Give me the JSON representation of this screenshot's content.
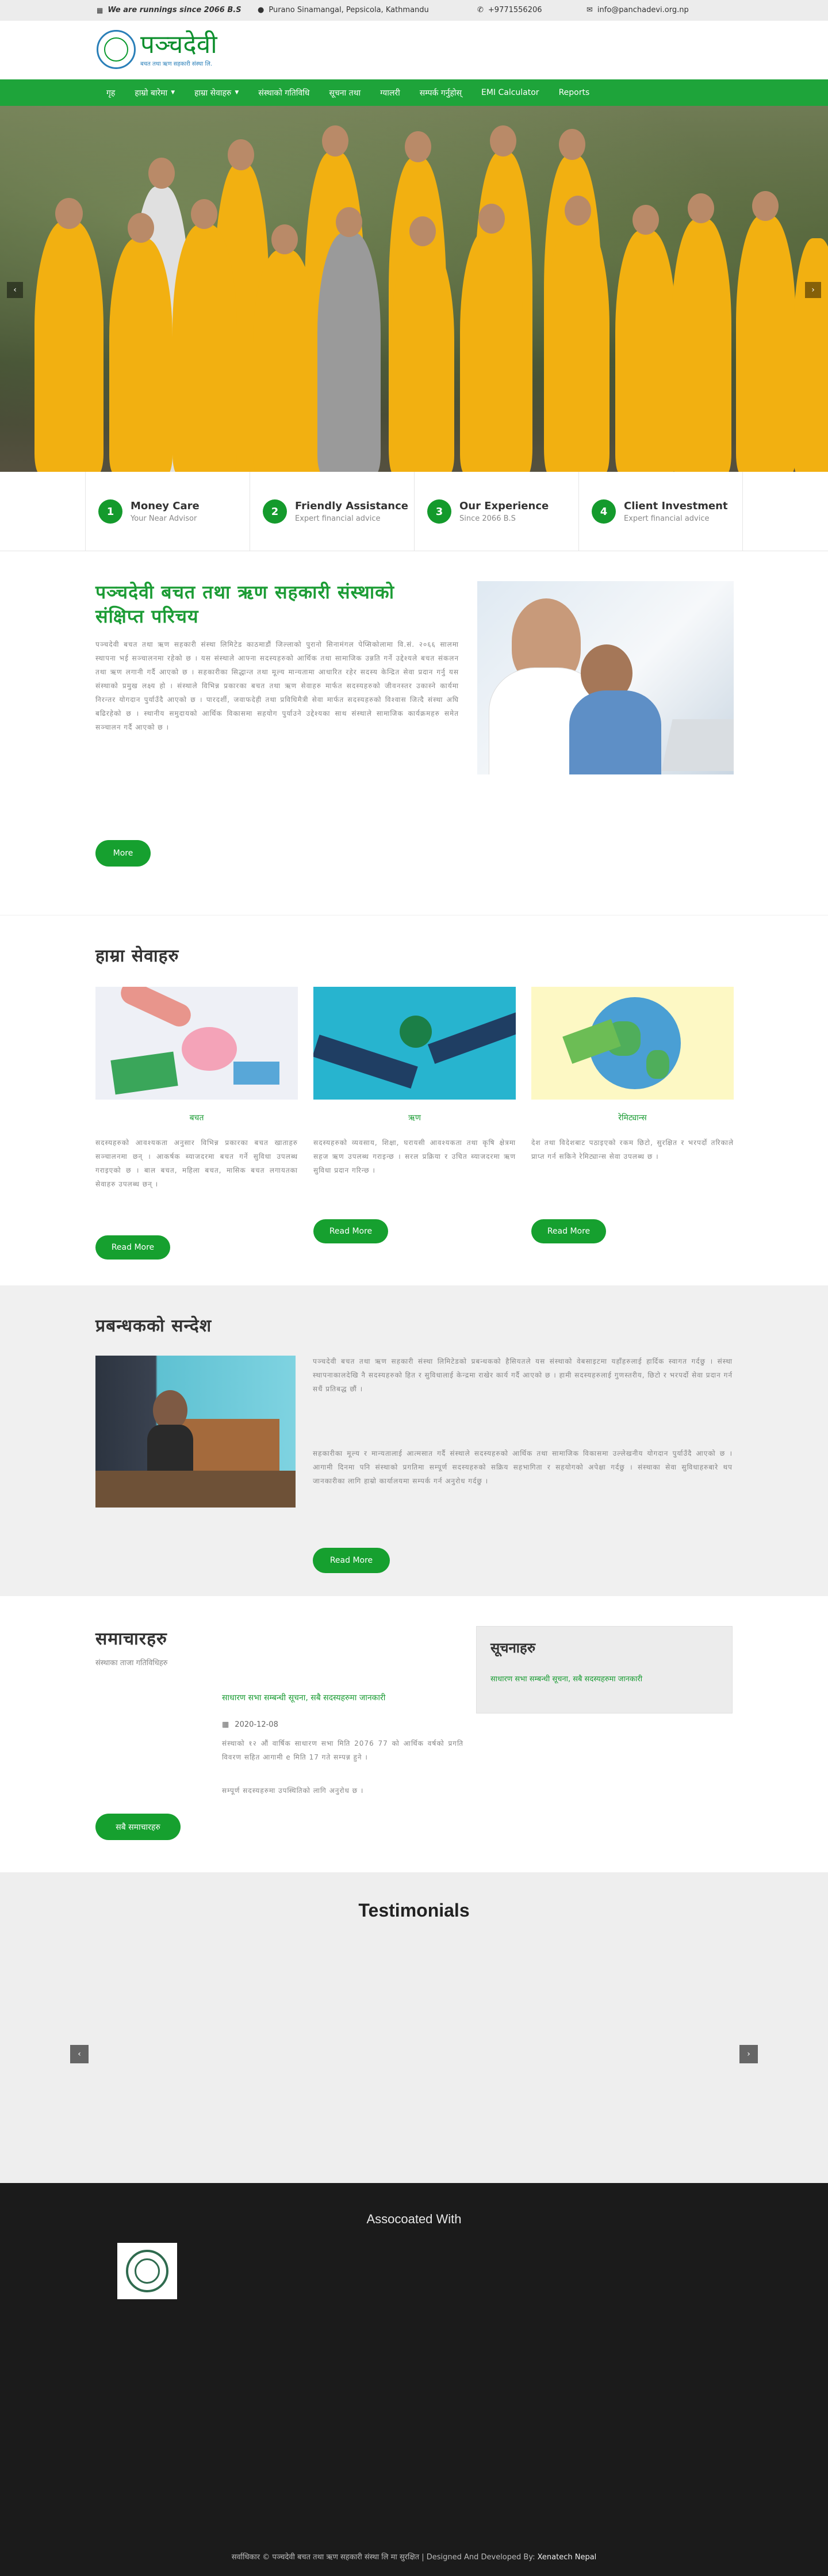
{
  "topbar": {
    "running": "We are runnings since 2066 B.S",
    "address": "Purano Sinamangal, Pepsicola, Kathmandu",
    "phone": "+9771556206",
    "email": "info@panchadevi.org.np"
  },
  "logo": {
    "title": "पञ्चदेवी",
    "subtitle": "बचत तथा ऋण सहकारी संस्था लि."
  },
  "nav": {
    "items": [
      {
        "label": "गृह"
      },
      {
        "label": "हाम्रो बारेमा",
        "dropdown": true
      },
      {
        "label": "हाम्रा सेवाहरु",
        "dropdown": true
      },
      {
        "label": "संस्थाको गतिविधि"
      },
      {
        "label": "सूचना तथा"
      },
      {
        "label": "ग्यालरी"
      },
      {
        "label": "सम्पर्क गर्नुहोस्"
      },
      {
        "label": "EMI Calculator"
      },
      {
        "label": "Reports"
      }
    ]
  },
  "features": [
    {
      "num": "1",
      "title": "Money Care",
      "sub": "Your Near Advisor"
    },
    {
      "num": "2",
      "title": "Friendly Assistance",
      "sub": "Expert financial advice"
    },
    {
      "num": "3",
      "title": "Our Experience",
      "sub": "Since 2066 B.S"
    },
    {
      "num": "4",
      "title": "Client Investment",
      "sub": "Expert financial advice"
    }
  ],
  "about": {
    "heading": "पञ्चदेवी बचत तथा ऋण सहकारी संस्थाको संक्षिप्त परिचय",
    "body": "पञ्चदेवी बचत तथा ऋण सहकारी संस्था लिमिटेड काठमाडौं जिल्लाको पुरानो सिनामंगल पेप्सिकोलामा वि.सं. २०६६ सालमा स्थापना भई सञ्चालनमा रहेको छ । यस संस्थाले आफ्ना सदस्यहरुको आर्थिक तथा सामाजिक उन्नति गर्ने उद्देश्यले बचत संकलन तथा ऋण लगानी गर्दै आएको छ । सहकारीका सिद्धान्त तथा मूल्य मान्यतामा आधारित रहेर सदस्य केन्द्रित सेवा प्रदान गर्नु यस संस्थाको प्रमुख लक्ष्य हो । संस्थाले विभिन्न प्रकारका बचत तथा ऋण सेवाहरु मार्फत सदस्यहरुको जीवनस्तर उकास्ने कार्यमा निरन्तर योगदान पुर्याउँदै आएको छ । पारदर्शी, जवाफदेही तथा प्रविधिमैत्री सेवा मार्फत सदस्यहरुको विश्वास जित्दै संस्था अघि बढिरहेको छ । स्थानीय समुदायको आर्थिक विकासमा सहयोग पुर्याउने उद्देश्यका साथ संस्थाले सामाजिक कार्यक्रमहरु समेत सञ्चालन गर्दै आएको छ ।",
    "more": "More"
  },
  "services": {
    "heading": "हाम्रा सेवाहरु",
    "items": [
      {
        "title": "बचत",
        "text": "सदस्यहरुको आवश्यकता अनुसार विभिन्न प्रकारका बचत खाताहरु सञ्चालनमा छन् । आकर्षक ब्याजदरमा बचत गर्ने सुविधा उपलब्ध गराइएको छ । बाल बचत, महिला बचत, मासिक बचत लगायतका सेवाहरु उपलब्ध छन् ।",
        "more": "Read More"
      },
      {
        "title": "ऋण",
        "text": "सदस्यहरुको व्यवसाय, शिक्षा, घरायसी आवश्यकता तथा कृषि क्षेत्रमा सहज ऋण उपलब्ध गराइन्छ । सरल प्रक्रिया र उचित ब्याजदरमा ऋण सुविधा प्रदान गरिन्छ ।",
        "more": "Read More"
      },
      {
        "title": "रेमिट्यान्स",
        "text": "देश तथा विदेशबाट पठाइएको रकम छिटो, सुरक्षित र भरपर्दो तरिकाले प्राप्त गर्न सकिने रेमिट्यान्स सेवा उपलब्ध छ ।",
        "more": "Read More"
      }
    ]
  },
  "manager": {
    "heading": "प्रबन्धकको सन्देश",
    "p1": "पञ्चदेवी बचत तथा ऋण सहकारी संस्था लिमिटेडको प्रबन्धकको हैसियतले यस संस्थाको वेबसाइटमा यहाँहरुलाई हार्दिक स्वागत गर्दछु । संस्था स्थापनाकालदेखि नै सदस्यहरुको हित र सुविधालाई केन्द्रमा राखेर कार्य गर्दै आएको छ । हामी सदस्यहरुलाई गुणस्तरीय, छिटो र भरपर्दो सेवा प्रदान गर्न सधैं प्रतिबद्ध छौं ।",
    "p2": "सहकारीका मूल्य र मान्यतालाई आत्मसात गर्दै संस्थाले सदस्यहरुको आर्थिक तथा सामाजिक विकासमा उल्लेखनीय योगदान पुर्याउँदै आएको छ । आगामी दिनमा पनि संस्थाको प्रगतिमा सम्पूर्ण सदस्यहरुको सक्रिय सहभागिता र सहयोगको अपेक्षा गर्दछु । संस्थाका सेवा सुविधाहरुबारे थप जानकारीका लागि हाम्रो कार्यालयमा सम्पर्क गर्न अनुरोध गर्दछु ।",
    "more": "Read More"
  },
  "news": {
    "heading": "समाचारहरु",
    "sub": "संस्थाका ताजा गतिविधिहरु",
    "item_title": "साधारण सभा सम्बन्धी सूचना, सबै सदस्यहरुमा जानकारी",
    "item_date": "2020-12-08",
    "item_text": "संस्थाको १२ औं वार्षिक साधारण सभा मिति 2076 77 को आर्थिक वर्षको प्रगति विवरण सहित आगामी e मिति 17 गते सम्पन्न हुने ।",
    "item_text2": "सम्पूर्ण सदस्यहरुमा उपस्थितिको लागि अनुरोध छ ।",
    "all": "सबै समाचारहरु",
    "notice_heading": "सूचनाहरु",
    "notice_item": "साधारण सभा सम्बन्धी सूचना, सबै सदस्यहरुमा जानकारी"
  },
  "testimonials": {
    "heading": "Testimonials"
  },
  "associated": {
    "heading": "Assocoated With"
  },
  "footer": {
    "copyright": "सर्वाधिकार © पञ्चदेवी बचत तथा ऋण सहकारी संस्था लि मा सुरक्षित",
    "designed": "| Designed And Developed By:",
    "developer": "Xenatech Nepal"
  }
}
